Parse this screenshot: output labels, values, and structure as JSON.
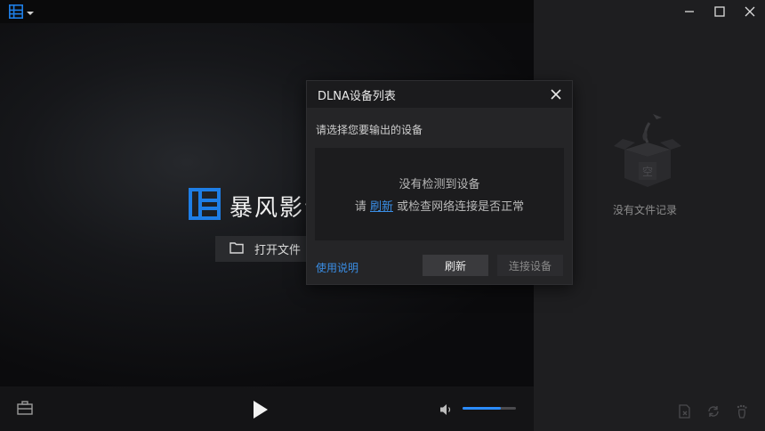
{
  "app": {
    "logo_text": "暴风影音",
    "brand_color": "#1e7ee6"
  },
  "main": {
    "open_file_label": "打开文件"
  },
  "right_panel": {
    "empty_label": "没有文件记录",
    "empty_box_glyph": "空"
  },
  "dialog": {
    "title": "DLNA设备列表",
    "prompt": "请选择您要输出的设备",
    "no_device": "没有检测到设备",
    "hint_prefix": "请 ",
    "hint_link": "刷新",
    "hint_suffix": " 或检查网络连接是否正常",
    "help_link": "使用说明",
    "refresh_button": "刷新",
    "connect_button": "连接设备"
  },
  "controls": {
    "volume_level": 0.72
  },
  "colors": {
    "accent": "#2b8cff",
    "link": "#3a8ee6"
  }
}
